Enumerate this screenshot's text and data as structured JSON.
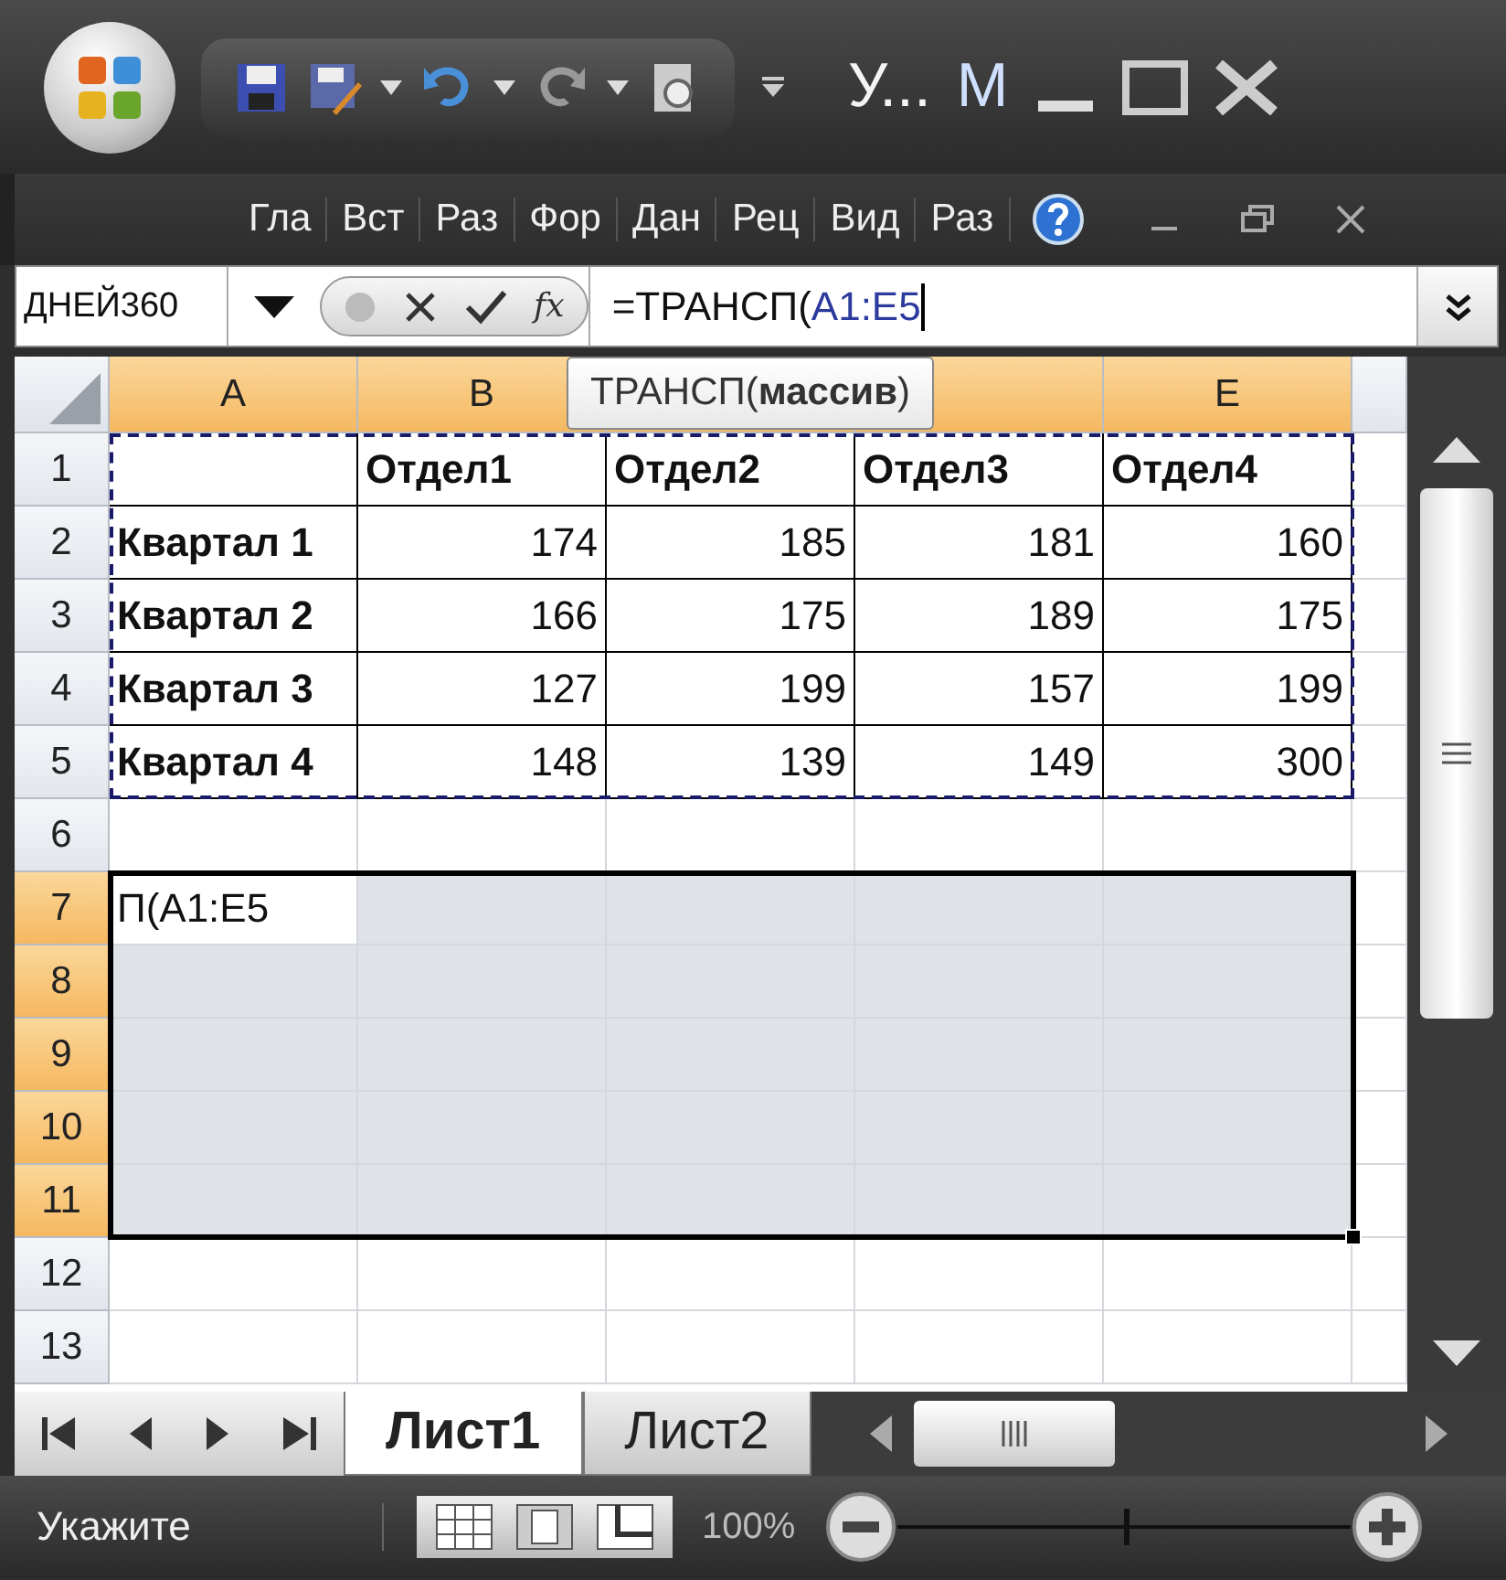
{
  "window": {
    "title": "У...",
    "app_title": "M"
  },
  "ribbon": {
    "tabs": [
      {
        "label": "Гла"
      },
      {
        "label": "Вст"
      },
      {
        "label": "Раз"
      },
      {
        "label": "Фор"
      },
      {
        "label": "Дан"
      },
      {
        "label": "Рец"
      },
      {
        "label": "Вид"
      },
      {
        "label": "Раз"
      }
    ]
  },
  "formula_bar": {
    "name_box": "ДНЕЙ360",
    "function_label": "fx",
    "formula": "=ТРАНСП(",
    "formula_ref": "A1:E5"
  },
  "tooltip": "ТРАНСП(**массив**)",
  "columns": [
    {
      "label": "A",
      "selected": true
    },
    {
      "label": "B",
      "selected": true
    },
    {
      "selected": true
    },
    {
      "selected": true
    },
    {
      "label": "E",
      "selected": true
    },
    {
      "selected": false
    }
  ],
  "rows": [
    {
      "header": "1",
      "kind": "header",
      "selected": false,
      "copied": true,
      "cells": [
        null,
        "Отдел1",
        "Отдел2",
        "Отдел3",
        "Отдел4"
      ]
    },
    {
      "header": "2",
      "kind": "data",
      "selected": false,
      "copied": true,
      "cells": [
        "Квартал 1",
        "174",
        "185",
        "181",
        "160"
      ]
    },
    {
      "header": "3",
      "kind": "data",
      "selected": false,
      "copied": true,
      "cells": [
        "Квартал 2",
        "166",
        "175",
        "189",
        "175"
      ]
    },
    {
      "header": "4",
      "kind": "data",
      "selected": false,
      "copied": true,
      "cells": [
        "Квартал 3",
        "127",
        "199",
        "157",
        "199"
      ]
    },
    {
      "header": "5",
      "kind": "data",
      "selected": false,
      "copied": true,
      "cells": [
        "Квартал 4",
        "148",
        "139",
        "149",
        "300"
      ]
    },
    {
      "header": "6",
      "kind": "blank",
      "selected": false,
      "copied": false,
      "cells": []
    },
    {
      "header": "7",
      "kind": "edit",
      "selected": true,
      "copied": false,
      "cells": [
        "П(A1:E5"
      ]
    },
    {
      "header": "8",
      "kind": "blank",
      "selected": true,
      "copied": false,
      "cells": []
    },
    {
      "header": "9",
      "kind": "blank",
      "selected": true,
      "copied": false,
      "cells": []
    },
    {
      "header": "10",
      "kind": "blank",
      "selected": true,
      "copied": false,
      "cells": []
    },
    {
      "header": "11",
      "kind": "blank",
      "selected": true,
      "copied": false,
      "cells": []
    },
    {
      "header": "12",
      "kind": "blank",
      "selected": false,
      "copied": false,
      "cells": []
    },
    {
      "header": "13",
      "kind": "blank",
      "selected": false,
      "copied": false,
      "cells": []
    }
  ],
  "sheet_tabs": [
    {
      "label": "Лист1",
      "selected": true
    },
    {
      "label": "Лист2",
      "selected": false
    }
  ],
  "status_bar": {
    "mode": "Укажите",
    "zoom": "100%",
    "zoom_slider": {
      "level": 0.5
    }
  }
}
